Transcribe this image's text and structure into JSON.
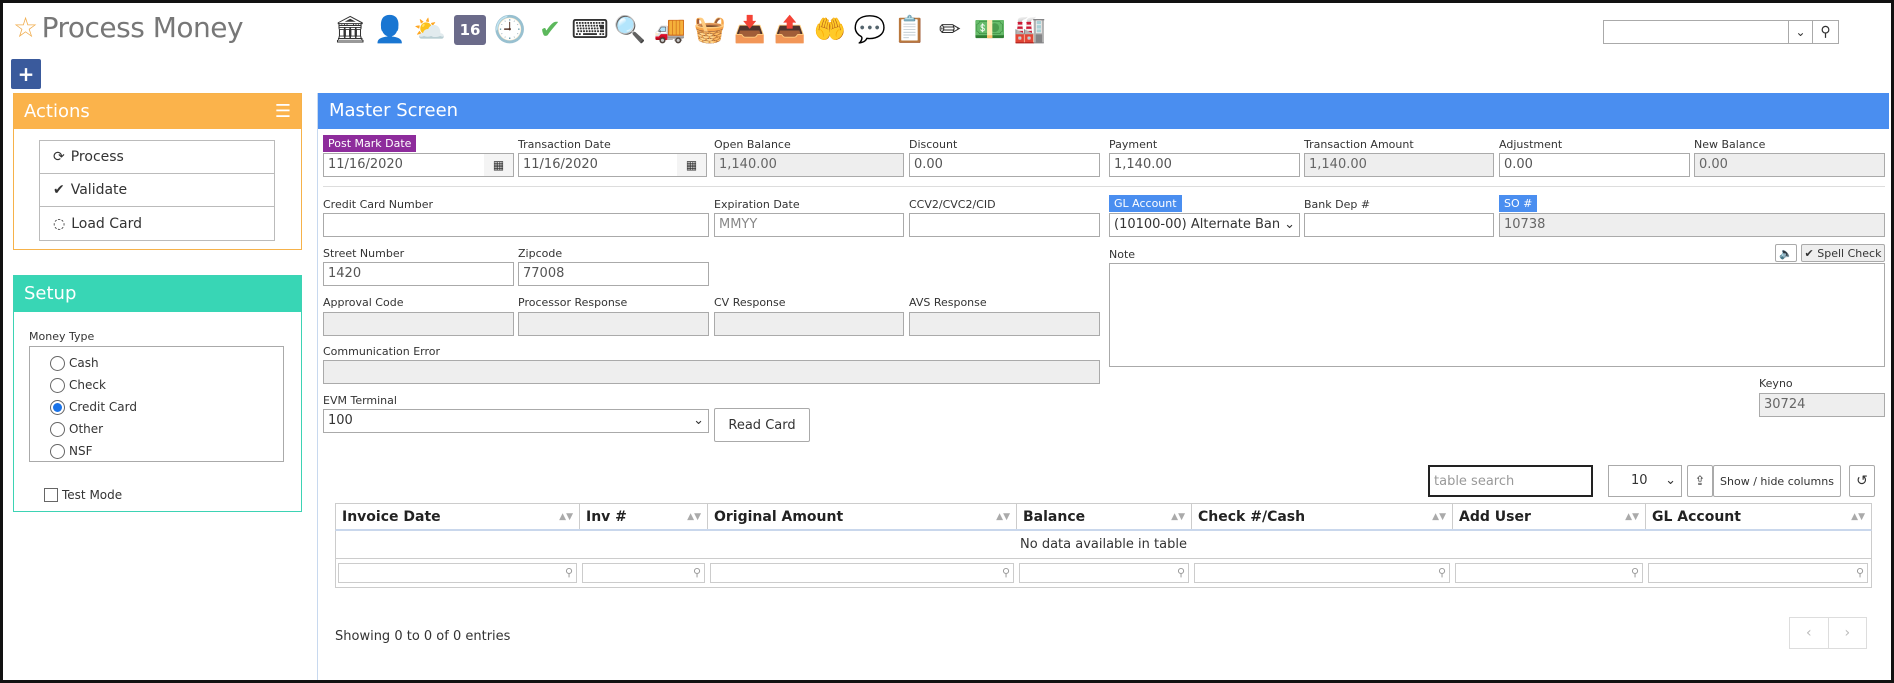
{
  "header": {
    "title": "Process Money",
    "search_value": ""
  },
  "toolbar_icons": [
    "bank-icon",
    "user-icon",
    "weather-icon",
    "calendar-16-icon",
    "clock-icon",
    "checkmark-icon",
    "keyboard-icon",
    "magnifier-icon",
    "truck-icon",
    "basket-icon",
    "download-box-icon",
    "upload-box-icon",
    "hand-money-icon",
    "dollar-chat-icon",
    "clipboard-icon",
    "pencil-icon",
    "money-icon",
    "factory-icon"
  ],
  "toolbar_calendar_number": "16",
  "actions": {
    "title": "Actions",
    "process": "Process",
    "validate": "Validate",
    "load_card": "Load Card"
  },
  "setup": {
    "title": "Setup",
    "money_type_label": "Money Type",
    "options": [
      "Cash",
      "Check",
      "Credit Card",
      "Other",
      "NSF"
    ],
    "selected": "Credit Card",
    "test_mode": "Test Mode"
  },
  "master": {
    "title": "Master Screen",
    "post_mark_date_label": "Post Mark Date",
    "post_mark_date": "11/16/2020",
    "transaction_date_label": "Transaction Date",
    "transaction_date": "11/16/2020",
    "open_balance_label": "Open Balance",
    "open_balance": "1,140.00",
    "discount_label": "Discount",
    "discount": "0.00",
    "payment_label": "Payment",
    "payment": "1,140.00",
    "transaction_amount_label": "Transaction Amount",
    "transaction_amount": "1,140.00",
    "adjustment_label": "Adjustment",
    "adjustment": "0.00",
    "new_balance_label": "New Balance",
    "new_balance": "0.00",
    "cc_number_label": "Credit Card Number",
    "cc_number": "",
    "exp_date_label": "Expiration Date",
    "exp_date_placeholder": "MMYY",
    "cvv_label": "CCV2/CVC2/CID",
    "cvv": "",
    "gl_account_label": "GL Account",
    "gl_account": "(10100-00) Alternate Ban",
    "bank_dep_label": "Bank Dep #",
    "bank_dep": "",
    "so_label": "SO #",
    "so": "10738",
    "street_number_label": "Street Number",
    "street_number": "1420",
    "zipcode_label": "Zipcode",
    "zipcode": "77008",
    "note_label": "Note",
    "spell_check": "Spell Check",
    "approval_code_label": "Approval Code",
    "processor_response_label": "Processor Response",
    "cv_response_label": "CV Response",
    "avs_response_label": "AVS Response",
    "comm_error_label": "Communication Error",
    "evm_terminal_label": "EVM Terminal",
    "evm_terminal": "100",
    "read_card": "Read Card",
    "keyno_label": "Keyno",
    "keyno": "30724"
  },
  "table": {
    "search_placeholder": "table search",
    "page_size": "10",
    "show_hide": "Show / hide columns",
    "columns": [
      "Invoice Date",
      "Inv #",
      "Original Amount",
      "Balance",
      "Check #/Cash",
      "Add User",
      "GL Account"
    ],
    "empty": "No data available in table",
    "showing": "Showing 0 to 0 of 0 entries"
  }
}
